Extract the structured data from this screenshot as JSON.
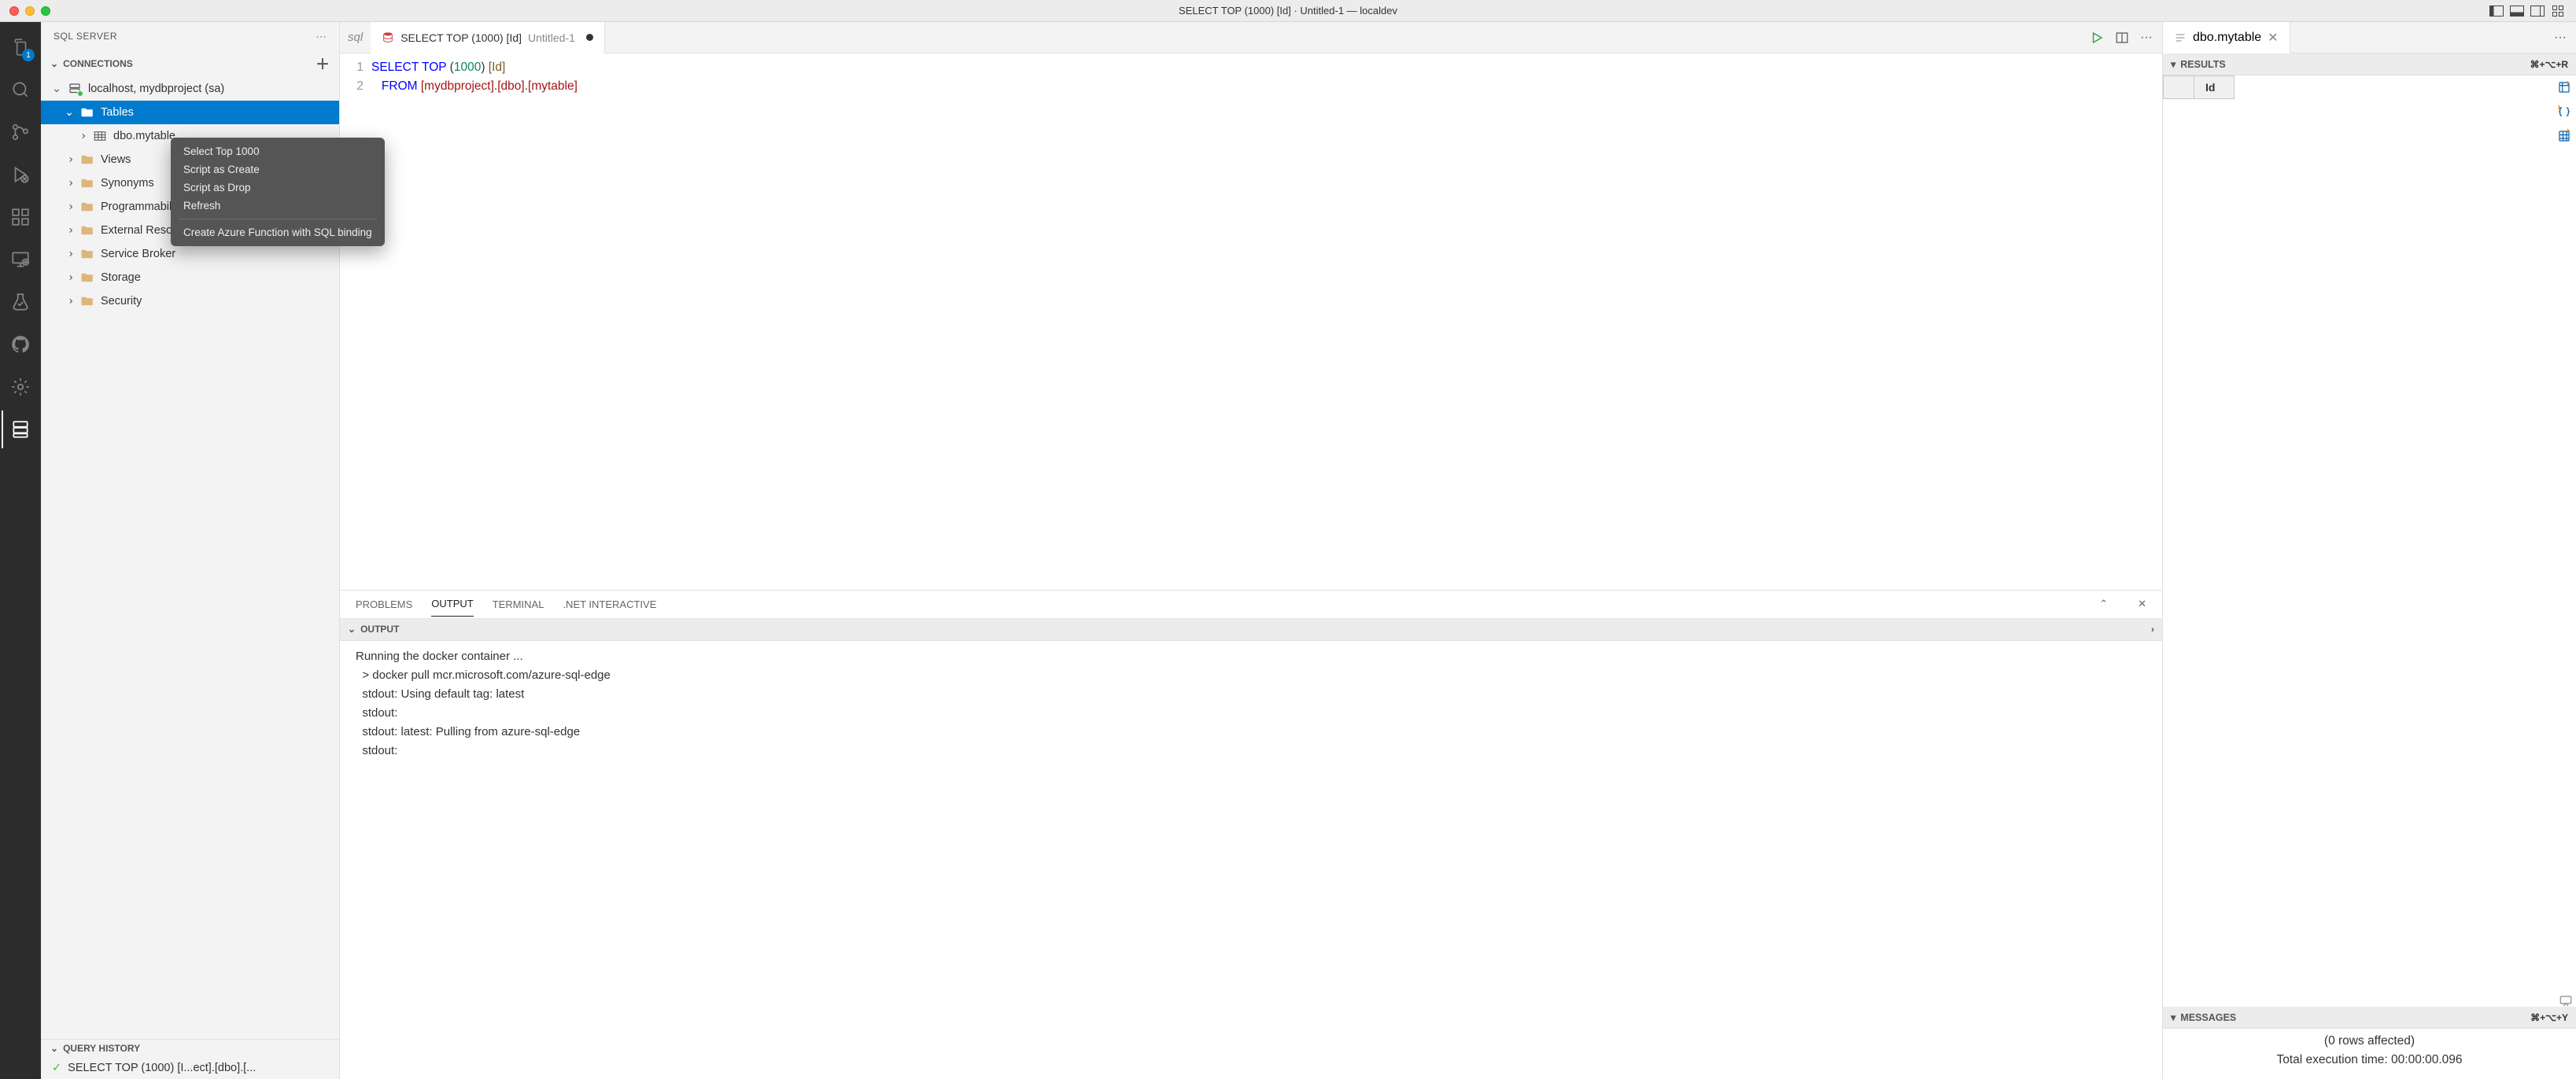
{
  "window": {
    "title": "SELECT TOP (1000) [Id] · Untitled-1 — localdev"
  },
  "activitybar": {
    "explorer_badge": "1"
  },
  "sidebar": {
    "title": "SQL SERVER",
    "sections": {
      "connections_label": "CONNECTIONS",
      "query_history_label": "QUERY HISTORY"
    },
    "connection_label": "localhost, mydbproject (sa)",
    "nodes": {
      "tables": "Tables",
      "mytable": "dbo.mytable",
      "views": "Views",
      "synonyms": "Synonyms",
      "programmability": "Programmability",
      "external": "External Resources",
      "service_broker": "Service Broker",
      "storage": "Storage",
      "security": "Security"
    },
    "query_history_item": "SELECT TOP (1000) [I...ect].[dbo].[..."
  },
  "context_menu": {
    "items": [
      "Select Top 1000",
      "Script as Create",
      "Script as Drop",
      "Refresh",
      "Create Azure Function with SQL binding"
    ]
  },
  "editor": {
    "peek_tab": "sql",
    "tab_title": "SELECT TOP (1000) [Id]",
    "tab_sub": "Untitled-1",
    "line_numbers": [
      "1",
      "2"
    ],
    "code": {
      "l1_select": "SELECT ",
      "l1_top": "TOP ",
      "l1_paren_open": "(",
      "l1_num": "1000",
      "l1_paren_close": ")",
      "l1_id": " [Id]",
      "l2_from": "   FROM ",
      "l2_b1": "[mydbproject]",
      "l2_dot1": ".",
      "l2_b2": "[dbo]",
      "l2_dot2": ".",
      "l2_b3": "[mytable]"
    }
  },
  "panel": {
    "tabs": {
      "problems": "PROBLEMS",
      "output": "OUTPUT",
      "terminal": "TERMINAL",
      "dotnet": ".NET INTERACTIVE"
    },
    "output_label": "OUTPUT",
    "output_lines": [
      "Running the docker container ...",
      "  > docker pull mcr.microsoft.com/azure-sql-edge",
      "  stdout: Using default tag: latest",
      "  stdout:",
      "  stdout: latest: Pulling from azure-sql-edge",
      "  stdout:"
    ]
  },
  "results": {
    "tab_label": "dbo.mytable",
    "results_label": "RESULTS",
    "results_shortcut": "⌘+⌥+R",
    "column_header": "Id",
    "messages_label": "MESSAGES",
    "messages_shortcut": "⌘+⌥+Y",
    "rows_affected": "(0 rows affected)",
    "exec_time": "Total execution time: 00:00:00.096"
  }
}
